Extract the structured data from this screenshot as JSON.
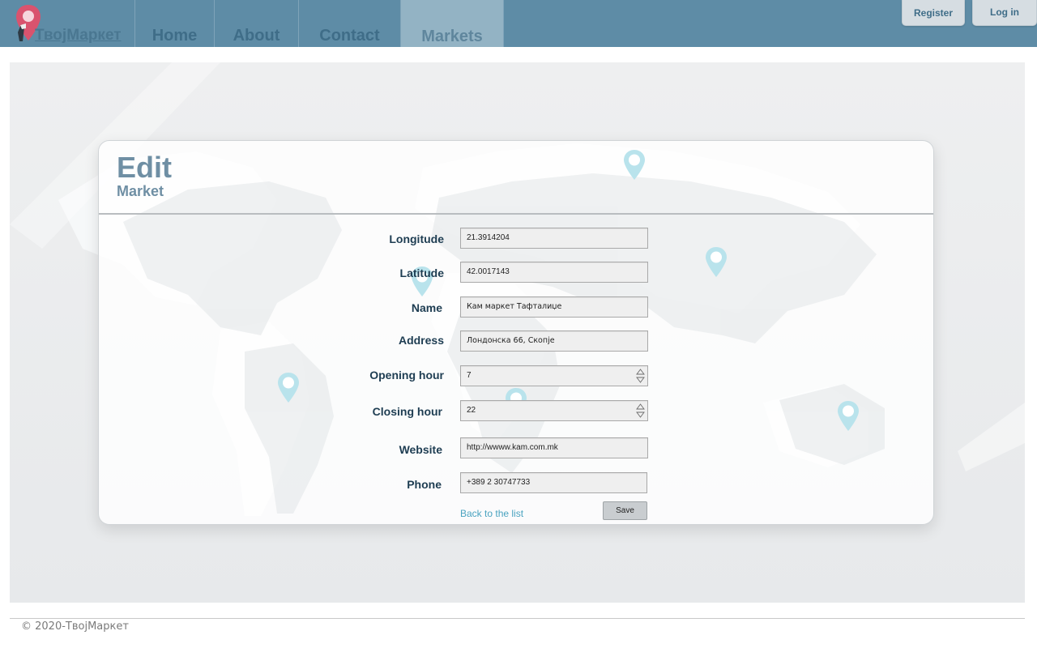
{
  "brand": {
    "name": "ТвојМаркет",
    "logo_icon": "map-pin-logo-icon"
  },
  "nav": {
    "items": [
      {
        "label": "Home"
      },
      {
        "label": "About"
      },
      {
        "label": "Contact"
      },
      {
        "label": "Markets",
        "active": true
      }
    ],
    "register_label": "Register",
    "login_label": "Log in"
  },
  "form": {
    "title": "Edit",
    "subtitle": "Market",
    "fields": [
      {
        "label": "Longitude",
        "value": "21.3914204"
      },
      {
        "label": "Latitude",
        "value": "42.0017143"
      },
      {
        "label": "Name",
        "value": "Кам маркет Тафталиџе"
      },
      {
        "label": "Address",
        "value": "Лондонска 66, Скопје"
      },
      {
        "label": "Opening hour",
        "value": "7"
      },
      {
        "label": "Closing hour",
        "value": "22"
      },
      {
        "label": "Website",
        "value": "http://wwww.kam.com.mk"
      },
      {
        "label": "Phone",
        "value": "+389 2 30747733"
      }
    ],
    "back_link": "Back to the list",
    "save_label": "Save"
  },
  "footer": {
    "text": "© 2020-ТвојМаркет"
  },
  "colors": {
    "navbar": "#5e8ca6",
    "nav_active": "#93b3c4",
    "nav_text": "#3f6d88",
    "label_text": "#1e3d52",
    "title_text": "#6f8fa4",
    "link": "#4aa3c0",
    "pin": "#b9e3ec",
    "brand_pin": "#d9536e"
  }
}
